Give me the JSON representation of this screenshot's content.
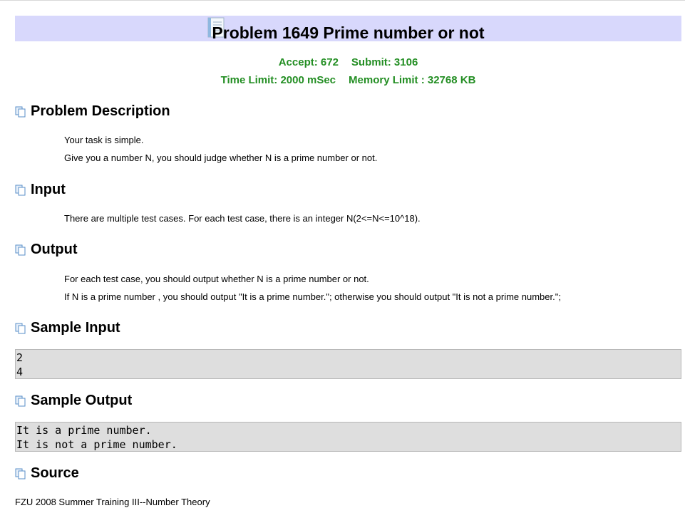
{
  "problem": {
    "title": "Problem 1649 Prime number or not",
    "title_icon": "document-icon"
  },
  "stats": {
    "accept": "Accept: 672",
    "submit": "Submit: 3106",
    "time_limit": "Time Limit: 2000 mSec",
    "memory_limit": "Memory Limit : 32768 KB",
    "color": "#238e23"
  },
  "sections": {
    "description": {
      "title": "Problem Description",
      "lines": [
        "Your task is simple.",
        "Give you a number N, you should judge whether N is a prime number or not."
      ]
    },
    "input": {
      "title": "Input",
      "lines": [
        "There are multiple test cases. For each test case, there is an integer N(2<=N<=10^18)."
      ]
    },
    "output": {
      "title": "Output",
      "lines": [
        "For each test case, you should output whether N is a prime number or not.",
        "If N is a prime number , you should output \"It is a prime number.\"; otherwise you should output \"It is not a prime number.\";"
      ]
    },
    "sample_input": {
      "title": "Sample Input",
      "lines": [
        "2",
        "4"
      ]
    },
    "sample_output": {
      "title": "Sample Output",
      "lines": [
        "It is a prime number.",
        "It is not a prime number."
      ]
    },
    "source": {
      "title": "Source",
      "text": "FZU 2008 Summer Training III--Number Theory"
    }
  },
  "section_icon": "copy-pages-icon",
  "colors": {
    "title_bar": "#d8d8fc",
    "sample_bg": "#dedede"
  }
}
